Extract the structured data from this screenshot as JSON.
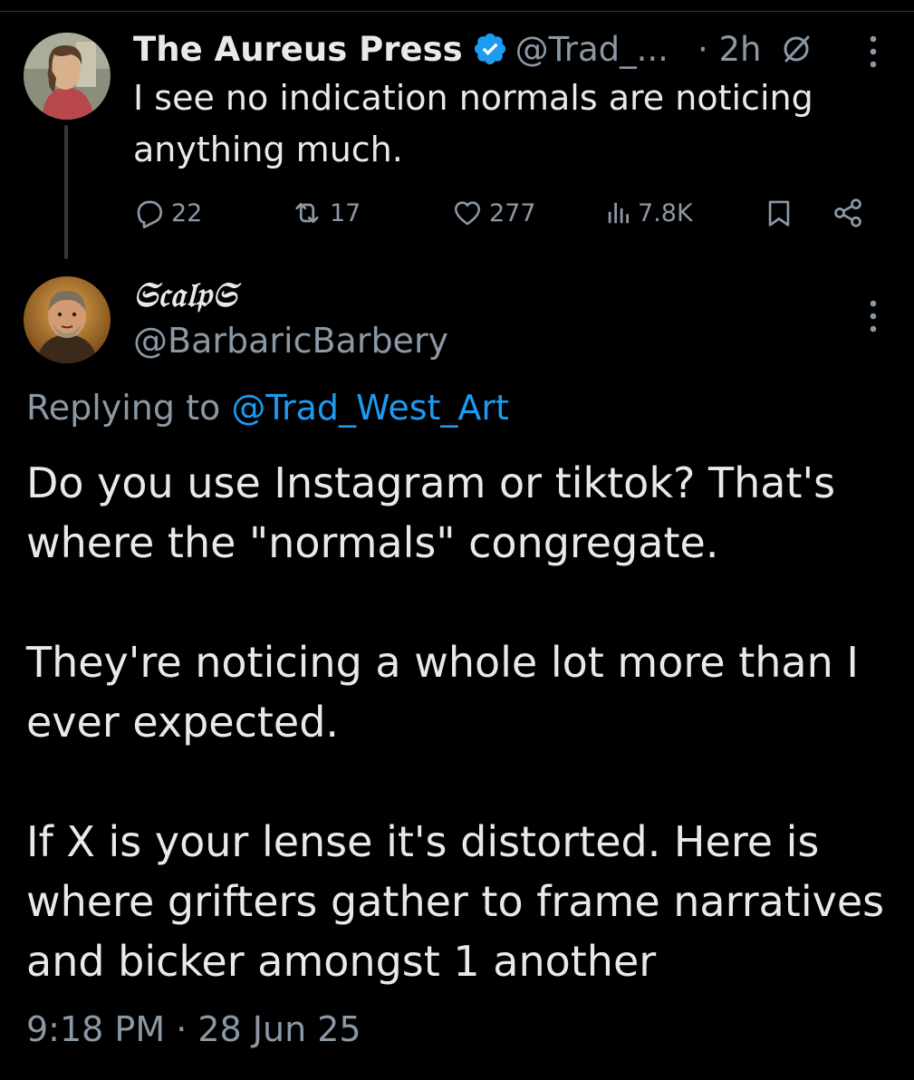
{
  "parent_tweet": {
    "author_name": "The Aureus Press",
    "handle": "@Trad_...",
    "time": "· 2h",
    "text": "I see no indication normals are noticing\nanything much.",
    "icons": {
      "avatar": "avatar-portrait",
      "verified": "verified-badge-icon",
      "grok": "slashed-circle-icon",
      "more": "more-vertical-icon"
    },
    "actions": {
      "replies": "22",
      "reposts": "17",
      "likes": "277",
      "views": "7.8K"
    }
  },
  "reply_tweet": {
    "author_name": "𝔖𝔠𝔞𝔩𝔭𝔖",
    "handle": "@BarbaricBarbery",
    "replying_prefix": "Replying to ",
    "replying_to": "@Trad_West_Art",
    "paragraphs": [
      "Do you use Instagram or tiktok? That's where the \"normals\" congregate.",
      "They're noticing a whole lot more than I ever expected.",
      "If X is your lense it's distorted. Here is where grifters gather to frame narratives and bicker amongst 1 another"
    ],
    "timestamp": "9:18 PM · 28 Jun 25"
  },
  "colors": {
    "background": "#000000",
    "text_primary": "#e7e9ea",
    "text_secondary": "#8b98a5",
    "accent": "#1d9bf0",
    "thread_line": "#333639"
  }
}
